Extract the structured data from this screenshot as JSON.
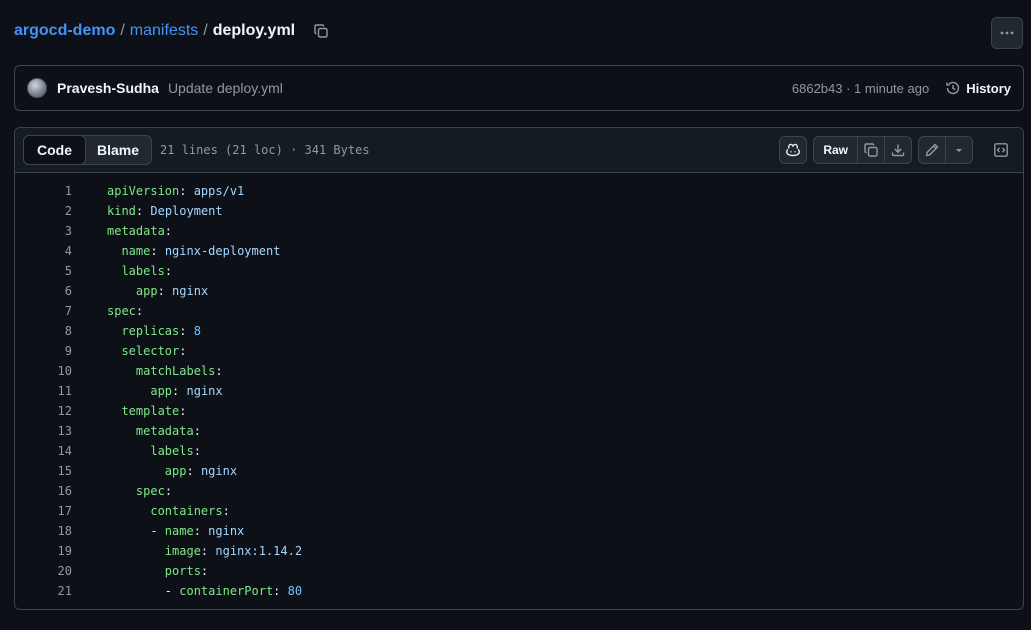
{
  "breadcrumb": {
    "repo": "argocd-demo",
    "sep": "/",
    "folder": "manifests",
    "file": "deploy.yml"
  },
  "commit": {
    "author": "Pravesh-Sudha",
    "message": "Update deploy.yml",
    "meta": "6862b43 · 1 minute ago",
    "history_label": "History"
  },
  "file_header": {
    "tabs": [
      {
        "label": "Code",
        "active": true
      },
      {
        "label": "Blame",
        "active": false
      }
    ],
    "info": "21 lines (21 loc) · 341 Bytes",
    "raw_label": "Raw"
  },
  "code_lines": [
    {
      "num": "1",
      "indent": "",
      "key": "apiVersion",
      "colon": ":",
      "value": " apps/v1",
      "vtype": "v"
    },
    {
      "num": "2",
      "indent": "",
      "key": "kind",
      "colon": ":",
      "value": " Deployment",
      "vtype": "v"
    },
    {
      "num": "3",
      "indent": "",
      "key": "metadata",
      "colon": ":",
      "value": "",
      "vtype": "v"
    },
    {
      "num": "4",
      "indent": "  ",
      "key": "name",
      "colon": ":",
      "value": " nginx-deployment",
      "vtype": "v"
    },
    {
      "num": "5",
      "indent": "  ",
      "key": "labels",
      "colon": ":",
      "value": "",
      "vtype": "v"
    },
    {
      "num": "6",
      "indent": "    ",
      "key": "app",
      "colon": ":",
      "value": " nginx",
      "vtype": "v"
    },
    {
      "num": "7",
      "indent": "",
      "key": "spec",
      "colon": ":",
      "value": "",
      "vtype": "v"
    },
    {
      "num": "8",
      "indent": "  ",
      "key": "replicas",
      "colon": ":",
      "value": " 8",
      "vtype": "n"
    },
    {
      "num": "9",
      "indent": "  ",
      "key": "selector",
      "colon": ":",
      "value": "",
      "vtype": "v"
    },
    {
      "num": "10",
      "indent": "    ",
      "key": "matchLabels",
      "colon": ":",
      "value": "",
      "vtype": "v"
    },
    {
      "num": "11",
      "indent": "      ",
      "key": "app",
      "colon": ":",
      "value": " nginx",
      "vtype": "v"
    },
    {
      "num": "12",
      "indent": "  ",
      "key": "template",
      "colon": ":",
      "value": "",
      "vtype": "v"
    },
    {
      "num": "13",
      "indent": "    ",
      "key": "metadata",
      "colon": ":",
      "value": "",
      "vtype": "v"
    },
    {
      "num": "14",
      "indent": "      ",
      "key": "labels",
      "colon": ":",
      "value": "",
      "vtype": "v"
    },
    {
      "num": "15",
      "indent": "        ",
      "key": "app",
      "colon": ":",
      "value": " nginx",
      "vtype": "v"
    },
    {
      "num": "16",
      "indent": "    ",
      "key": "spec",
      "colon": ":",
      "value": "",
      "vtype": "v"
    },
    {
      "num": "17",
      "indent": "      ",
      "key": "containers",
      "colon": ":",
      "value": "",
      "vtype": "v"
    },
    {
      "num": "18",
      "indent": "      - ",
      "key": "name",
      "colon": ":",
      "value": " nginx",
      "vtype": "v"
    },
    {
      "num": "19",
      "indent": "        ",
      "key": "image",
      "colon": ":",
      "value": " nginx:1.14.2",
      "vtype": "v"
    },
    {
      "num": "20",
      "indent": "        ",
      "key": "ports",
      "colon": ":",
      "value": "",
      "vtype": "v"
    },
    {
      "num": "21",
      "indent": "        - ",
      "key": "containerPort",
      "colon": ":",
      "value": " 80",
      "vtype": "n"
    }
  ],
  "icons": {
    "copy_path": "copy-icon",
    "more": "kebab-horizontal-icon",
    "history": "history-icon",
    "copilot": "copilot-icon",
    "copy_raw": "copy-icon",
    "download": "download-icon",
    "edit": "pencil-icon",
    "edit_menu": "triangle-down-icon",
    "symbols": "code-square-icon"
  },
  "colors": {
    "background": "#0d1117",
    "link": "#4493f8",
    "yaml_key": "#7ee787",
    "yaml_value": "#a5d6ff",
    "yaml_number": "#79c0ff"
  }
}
